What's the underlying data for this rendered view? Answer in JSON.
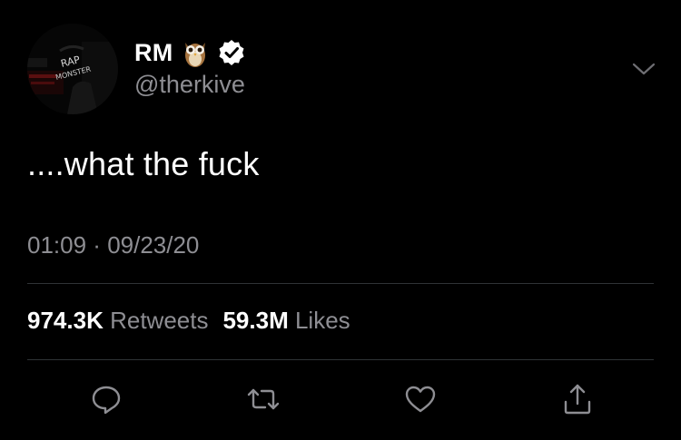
{
  "user": {
    "display_name": "RM",
    "handle": "@therkive",
    "emoji": "owl-emoji-icon",
    "verified": true,
    "avatar_text_line1": "RAP",
    "avatar_text_line2": "MONSTER"
  },
  "tweet": {
    "text": "....what the fuck",
    "time": "01:09",
    "separator": " · ",
    "date": "09/23/20"
  },
  "stats": {
    "retweets_count": "974.3K",
    "retweets_label": "Retweets",
    "likes_count": "59.3M",
    "likes_label": "Likes"
  },
  "actions": {
    "reply_icon": "reply-icon",
    "retweet_icon": "retweet-icon",
    "like_icon": "heart-icon",
    "share_icon": "share-icon"
  },
  "colors": {
    "background": "#000000",
    "text_primary": "#ffffff",
    "text_secondary": "#8e8e93",
    "verified_badge": "#ffffff",
    "divider": "#2f3336"
  }
}
